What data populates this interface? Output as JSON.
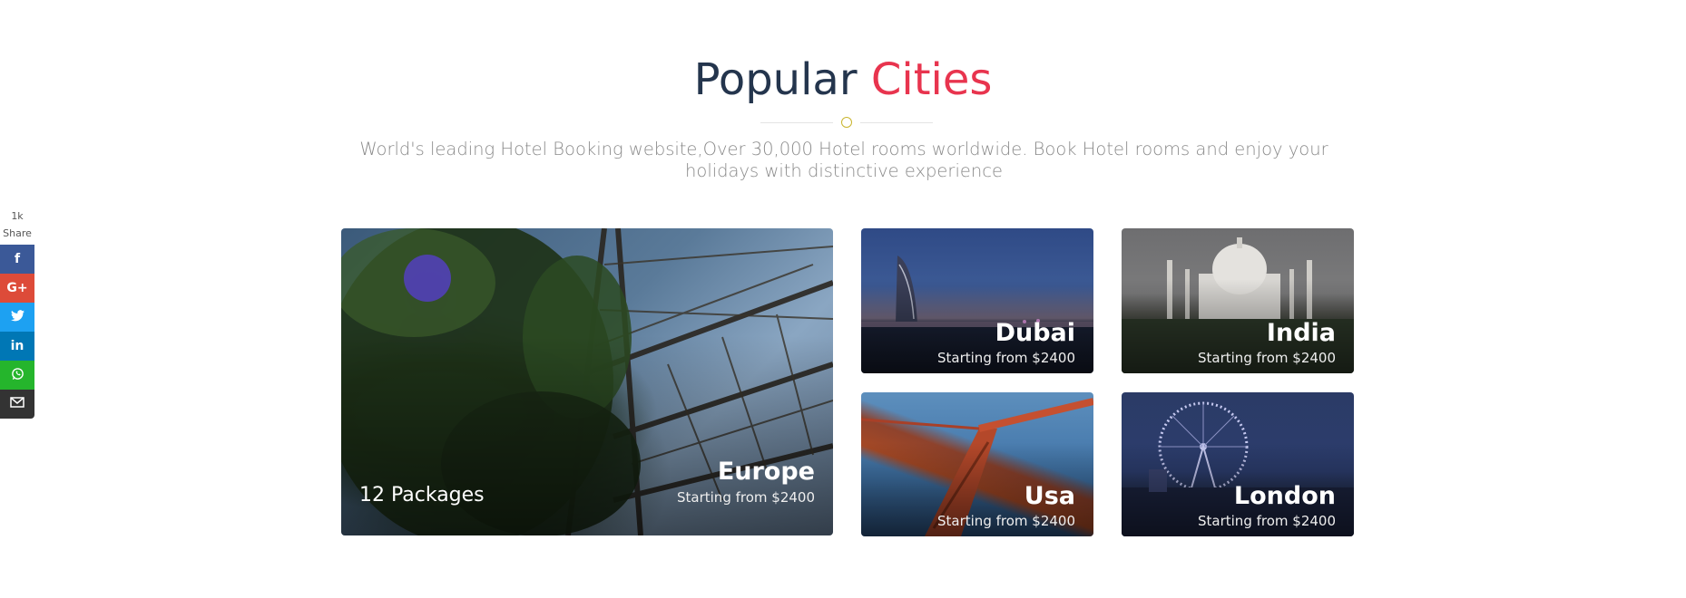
{
  "heading": {
    "main": "Popular",
    "accent": "Cities"
  },
  "subtitle": "World's leading Hotel Booking website,Over 30,000 Hotel rooms worldwide. Book Hotel rooms and enjoy your holidays with distinctive experience",
  "share": {
    "count": "1k",
    "label": "Share",
    "buttons": [
      {
        "icon": "facebook-icon",
        "glyph": "f",
        "color": "#3b5998"
      },
      {
        "icon": "google-plus-icon",
        "glyph": "G+",
        "color": "#dd4b39"
      },
      {
        "icon": "twitter-icon",
        "glyph": "t",
        "color": "#1da1f2"
      },
      {
        "icon": "linkedin-icon",
        "glyph": "in",
        "color": "#0077b5"
      },
      {
        "icon": "whatsapp-icon",
        "glyph": "☏",
        "color": "#25b52c"
      },
      {
        "icon": "email-icon",
        "glyph": "✉",
        "color": "#333333"
      }
    ]
  },
  "colors": {
    "heading": "#24354d",
    "accent": "#e8344e",
    "subtitle": "#8a8a8a"
  },
  "cities": {
    "europe": {
      "name": "Europe",
      "price": "Starting from $2400",
      "packages": "12 Packages"
    },
    "dubai": {
      "name": "Dubai",
      "price": "Starting from $2400"
    },
    "india": {
      "name": "India",
      "price": "Starting from $2400"
    },
    "usa": {
      "name": "Usa",
      "price": "Starting from $2400"
    },
    "london": {
      "name": "London",
      "price": "Starting from $2400"
    }
  }
}
